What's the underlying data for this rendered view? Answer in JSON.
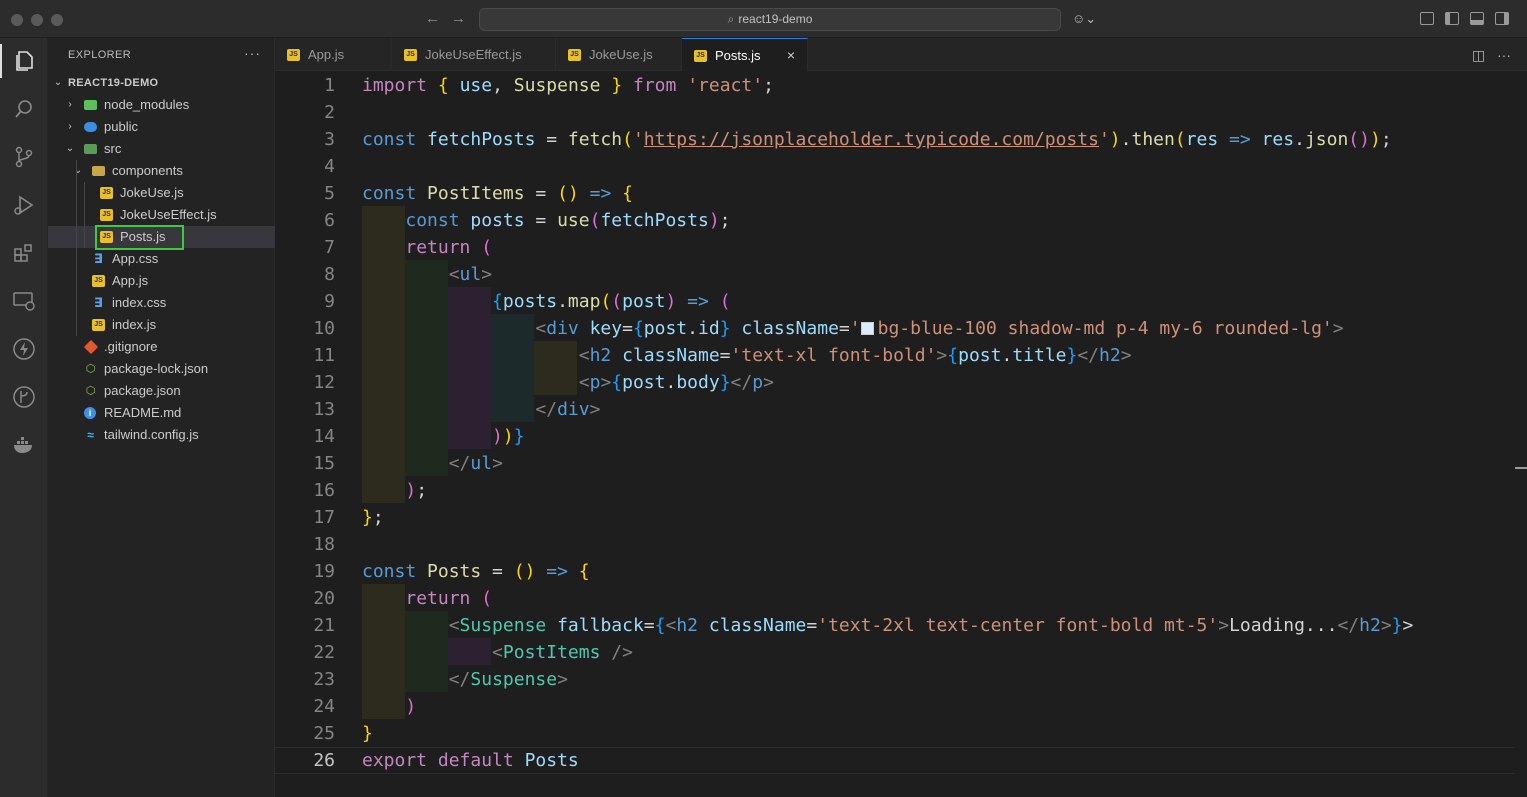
{
  "window": {
    "search_text": "react19-demo"
  },
  "sidebar": {
    "title": "EXPLORER",
    "more": "···",
    "project": "REACT19-DEMO",
    "tree": [
      "node_modules",
      "public",
      "src",
      "components",
      "JokeUse.js",
      "JokeUseEffect.js",
      "Posts.js",
      "App.css",
      "App.js",
      "index.css",
      "index.js",
      ".gitignore",
      "package-lock.json",
      "package.json",
      "README.md",
      "tailwind.config.js"
    ],
    "selected": "Posts.js"
  },
  "tabs": [
    {
      "label": "App.js",
      "active": false
    },
    {
      "label": "JokeUseEffect.js",
      "active": false
    },
    {
      "label": "JokeUse.js",
      "active": false
    },
    {
      "label": "Posts.js",
      "active": true
    }
  ],
  "tab_close": "×",
  "editor": {
    "current_line": 26,
    "line_numbers": [
      "1",
      "2",
      "3",
      "4",
      "5",
      "6",
      "7",
      "8",
      "9",
      "10",
      "11",
      "12",
      "13",
      "14",
      "15",
      "16",
      "17",
      "18",
      "19",
      "20",
      "21",
      "22",
      "23",
      "24",
      "25",
      "26"
    ],
    "code_lines": [
      "import { use, Suspense } from 'react';",
      "",
      "const fetchPosts = fetch('https://jsonplaceholder.typicode.com/posts').then(res => res.json());",
      "",
      "const PostItems = () => {",
      "    const posts = use(fetchPosts);",
      "    return (",
      "        <ul>",
      "            {posts.map((post) => (",
      "                <div key={post.id} className='bg-blue-100 shadow-md p-4 my-6 rounded-lg'>",
      "                    <h2 className='text-xl font-bold'>{post.title}</h2>",
      "                    <p>{post.body}</p>",
      "                </div>",
      "            ))}",
      "        </ul>",
      "    );",
      "};",
      "",
      "const Posts = () => {",
      "    return (",
      "        <Suspense fallback={<h2 className='text-2xl text-center font-bold mt-5'>Loading...</h2>}>",
      "            <PostItems />",
      "        </Suspense>",
      "    )",
      "}",
      "export default Posts"
    ]
  },
  "colors": {
    "keyword": "#c586c0",
    "storage": "#569cd6",
    "function": "#dcdcaa",
    "variable": "#9cdcfe",
    "string": "#ce9178",
    "component": "#4ec9b0",
    "swatch_bg_blue_100": "#dbeafe",
    "selection_box": "#3ec93e"
  }
}
